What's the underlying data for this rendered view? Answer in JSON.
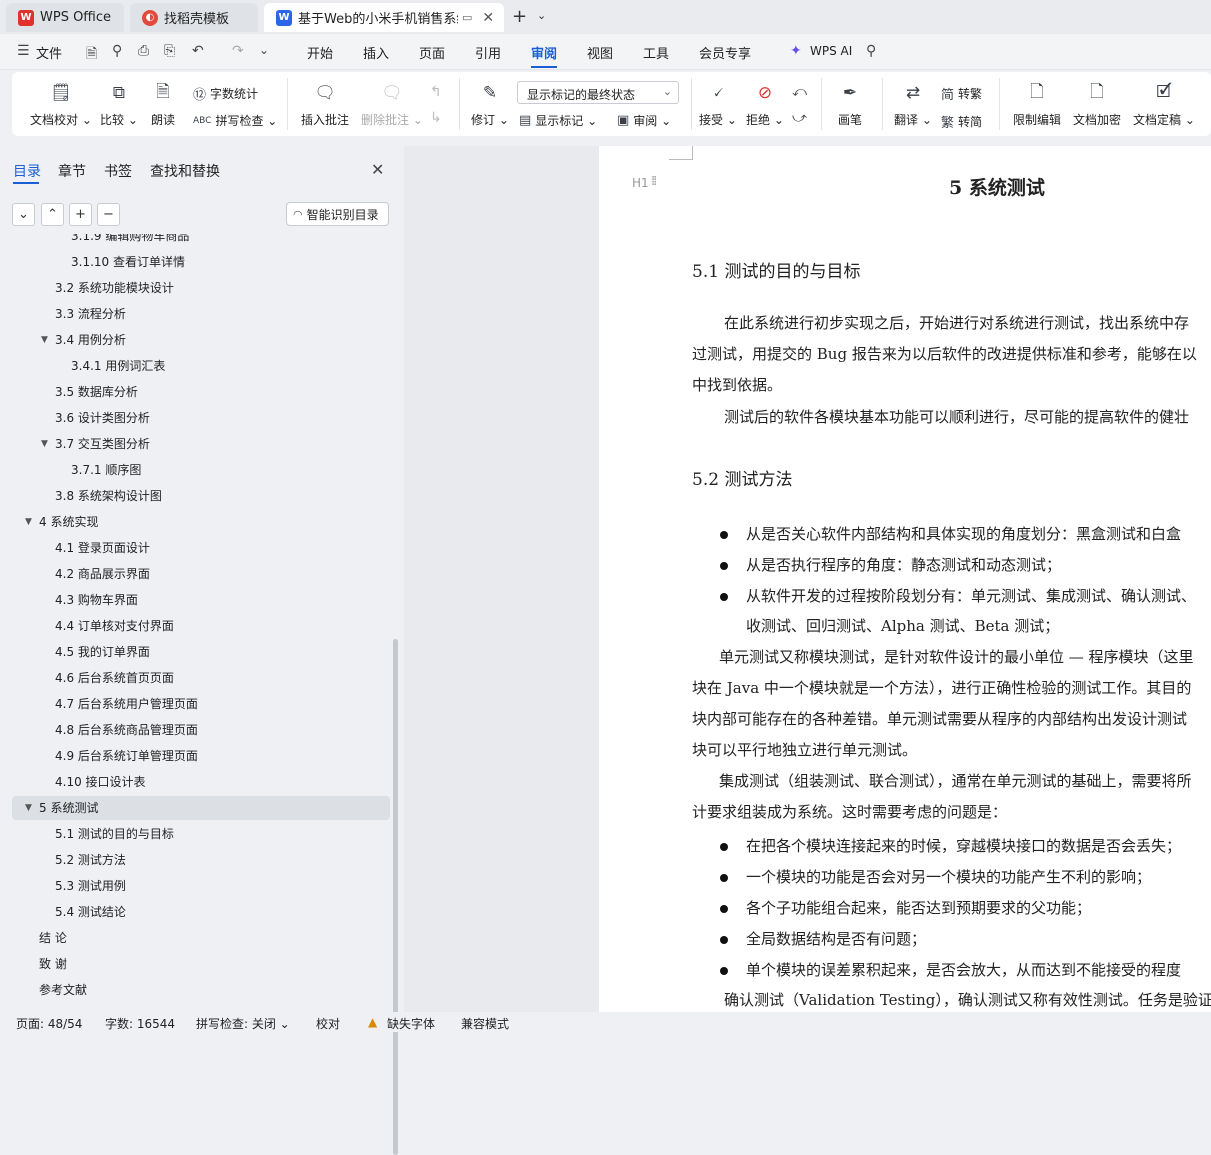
{
  "tabs": {
    "wps": "WPS Office",
    "template": "找稻壳模板",
    "document": "基于Web的小米手机销售系统"
  },
  "menu": {
    "file": "文件",
    "items": [
      "开始",
      "插入",
      "页面",
      "引用",
      "审阅",
      "视图",
      "工具",
      "会员专享"
    ],
    "active": "审阅",
    "wps_ai": "WPS AI"
  },
  "ribbon": {
    "doc_proof": "文档校对",
    "compare": "比较",
    "read_aloud": "朗读",
    "word_count": "字数统计",
    "spell_check": "拼写检查",
    "insert_comment": "插入批注",
    "delete_comment": "删除批注",
    "track_changes": "修订",
    "markup_state": "显示标记的最终状态",
    "show_markup": "显示标记",
    "review_pane": "审阅",
    "accept": "接受",
    "reject": "拒绝",
    "ink": "画笔",
    "translate": "翻译",
    "to_traditional": "转繁",
    "to_simplified": "转简",
    "restrict_edit": "限制编辑",
    "encrypt": "文档加密",
    "finalize": "文档定稿"
  },
  "nav": {
    "tabs": [
      "目录",
      "章节",
      "书签",
      "查找和替换"
    ],
    "active_tab": "目录",
    "smart_toc": "智能识别目录",
    "toc": [
      {
        "label": "3.1.9 编辑购物车商品",
        "level": 3,
        "arrow": ""
      },
      {
        "label": "3.1.10 查看订单详情",
        "level": 3,
        "arrow": ""
      },
      {
        "label": "3.2  系统功能模块设计",
        "level": 2,
        "arrow": ""
      },
      {
        "label": "3.3  流程分析",
        "level": 2,
        "arrow": ""
      },
      {
        "label": "3.4  用例分析",
        "level": 2,
        "arrow": "▼"
      },
      {
        "label": "3.4.1 用例词汇表",
        "level": 3,
        "arrow": ""
      },
      {
        "label": "3.5  数据库分析",
        "level": 2,
        "arrow": ""
      },
      {
        "label": "3.6 设计类图分析",
        "level": 2,
        "arrow": ""
      },
      {
        "label": "3.7  交互类图分析",
        "level": 2,
        "arrow": "▼"
      },
      {
        "label": "3.7.1 顺序图",
        "level": 3,
        "arrow": ""
      },
      {
        "label": "3.8  系统架构设计图",
        "level": 2,
        "arrow": ""
      },
      {
        "label": "4  系统实现",
        "level": 1,
        "arrow": "▼"
      },
      {
        "label": "4.1 登录页面设计",
        "level": 2,
        "arrow": ""
      },
      {
        "label": "4.2 商品展示界面",
        "level": 2,
        "arrow": ""
      },
      {
        "label": "4.3  购物车界面",
        "level": 2,
        "arrow": ""
      },
      {
        "label": "4.4 订单核对支付界面",
        "level": 2,
        "arrow": ""
      },
      {
        "label": "4.5 我的订单界面",
        "level": 2,
        "arrow": ""
      },
      {
        "label": "4.6 后台系统首页页面",
        "level": 2,
        "arrow": ""
      },
      {
        "label": "4.7 后台系统用户管理页面",
        "level": 2,
        "arrow": ""
      },
      {
        "label": "4.8 后台系统商品管理页面",
        "level": 2,
        "arrow": ""
      },
      {
        "label": "4.9 后台系统订单管理页面",
        "level": 2,
        "arrow": ""
      },
      {
        "label": "4.10 接口设计表",
        "level": 2,
        "arrow": ""
      },
      {
        "label": "5  系统测试",
        "level": 1,
        "arrow": "▼",
        "selected": true
      },
      {
        "label": "5.1  测试的目的与目标",
        "level": 2,
        "arrow": ""
      },
      {
        "label": "5.2  测试方法",
        "level": 2,
        "arrow": ""
      },
      {
        "label": "5.3  测试用例",
        "level": 2,
        "arrow": ""
      },
      {
        "label": "5.4  测试结论",
        "level": 2,
        "arrow": ""
      },
      {
        "label": "结  论",
        "level": 1,
        "arrow": ""
      },
      {
        "label": "致  谢",
        "level": 1,
        "arrow": ""
      },
      {
        "label": "参考文献",
        "level": 1,
        "arrow": ""
      }
    ]
  },
  "document": {
    "h1_hint": "H1",
    "chapter_title": "5  系统测试",
    "sec1_title": "5.1  测试的目的与目标",
    "sec1_p1": "在此系统进行初步实现之后，开始进行对系统进行测试，找出系统中存",
    "sec1_p2": "过测试，用提交的 Bug 报告来为以后软件的改进提供标准和参考，能够在以",
    "sec1_p3": "中找到依据。",
    "sec1_p4": "测试后的软件各模块基本功能可以顺利进行，尽可能的提高软件的健壮",
    "sec2_title": "5.2  测试方法",
    "bullets1": [
      "从是否关心软件内部结构和具体实现的角度划分：黑盒测试和白盒",
      "从是否执行程序的角度：静态测试和动态测试；",
      "从软件开发的过程按阶段划分有：单元测试、集成测试、确认测试、"
    ],
    "bullet3_cont": "收测试、回归测试、Alpha 测试、Beta 测试；",
    "unit_p1": "单元测试又称模块测试，是针对软件设计的最小单位 — 程序模块（这里",
    "unit_p2": "块在 Java 中一个模块就是一个方法），进行正确性检验的测试工作。其目的",
    "unit_p3": "块内部可能存在的各种差错。单元测试需要从程序的内部结构出发设计测试",
    "unit_p4": "块可以平行地独立进行单元测试。",
    "integ_p1": "集成测试（组装测试、联合测试），通常在单元测试的基础上，需要将所",
    "integ_p2": "计要求组装成为系统。这时需要考虑的问题是：",
    "bullets2": [
      "在把各个模块连接起来的时候，穿越模块接口的数据是否会丢失；",
      "一个模块的功能是否会对另一个模块的功能产生不利的影响；",
      "各个子功能组合起来，能否达到预期要求的父功能；",
      "全局数据结构是否有问题；",
      "单个模块的误差累积起来，是否会放大，从而达到不能接受的程度"
    ],
    "valid_p1": "确认测试（Validation Testing），确认测试又称有效性测试。任务是验证"
  },
  "status": {
    "page": "页面: 48/54",
    "words": "字数: 16544",
    "spell": "拼写检查: 关闭",
    "proof": "校对",
    "missing_font": "缺失字体",
    "compat": "兼容模式"
  },
  "colors": {
    "accent": "#1a5fd6",
    "warn": "#d98a00"
  }
}
